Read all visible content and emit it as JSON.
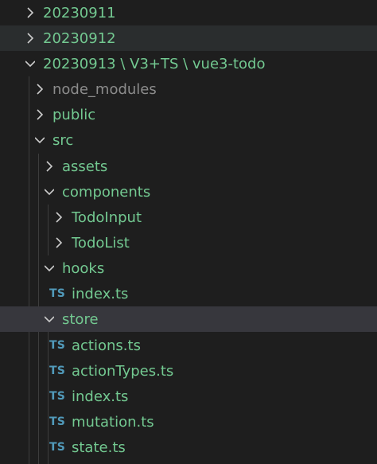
{
  "colors": {
    "background": "#1e1e1e",
    "modified": "#73c991",
    "ignored": "#8c8c8c",
    "ts_icon": "#519aba",
    "hover_row": "#2a2d2e",
    "selected_row": "#37373d"
  },
  "explorer": {
    "items": [
      {
        "label": "20230911",
        "type": "folder",
        "expanded": false
      },
      {
        "label": "20230912",
        "type": "folder",
        "expanded": false
      },
      {
        "label": "20230913 \\ V3+TS \\ vue3-todo",
        "type": "folder",
        "expanded": true
      },
      {
        "label": "node_modules",
        "type": "folder",
        "expanded": false
      },
      {
        "label": "public",
        "type": "folder",
        "expanded": false
      },
      {
        "label": "src",
        "type": "folder",
        "expanded": true
      },
      {
        "label": "assets",
        "type": "folder",
        "expanded": false
      },
      {
        "label": "components",
        "type": "folder",
        "expanded": true
      },
      {
        "label": "TodoInput",
        "type": "folder",
        "expanded": false
      },
      {
        "label": "TodoList",
        "type": "folder",
        "expanded": false
      },
      {
        "label": "hooks",
        "type": "folder",
        "expanded": true
      },
      {
        "label": "index.ts",
        "type": "file",
        "icon": "TS"
      },
      {
        "label": "store",
        "type": "folder",
        "expanded": true
      },
      {
        "label": "actions.ts",
        "type": "file",
        "icon": "TS"
      },
      {
        "label": "actionTypes.ts",
        "type": "file",
        "icon": "TS"
      },
      {
        "label": "index.ts",
        "type": "file",
        "icon": "TS"
      },
      {
        "label": "mutation.ts",
        "type": "file",
        "icon": "TS"
      },
      {
        "label": "state.ts",
        "type": "file",
        "icon": "TS"
      }
    ]
  }
}
